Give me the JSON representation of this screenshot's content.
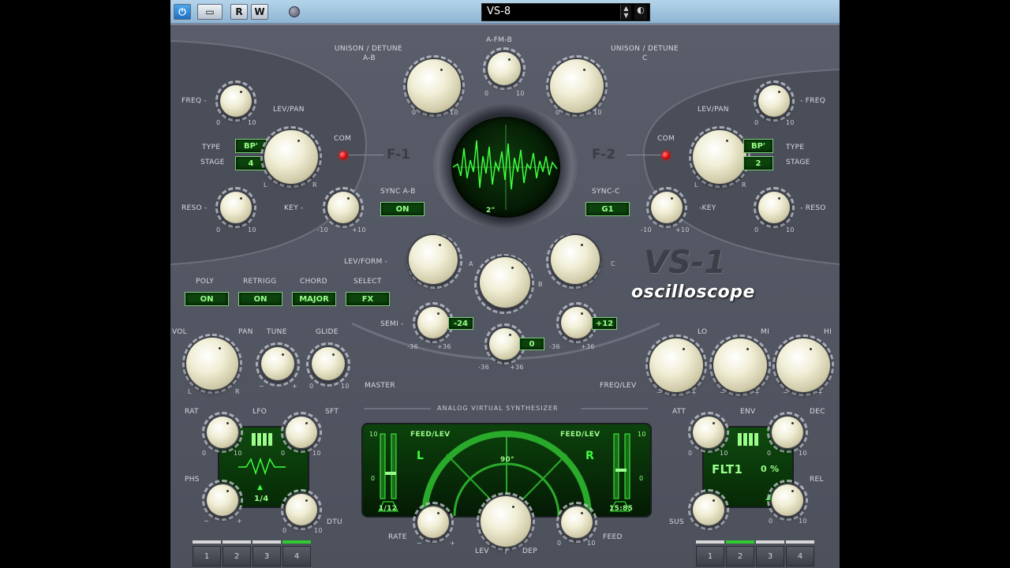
{
  "host": {
    "power_label": "",
    "r_label": "R",
    "w_label": "W",
    "preset_name": "VS-8"
  },
  "top": {
    "unison_ab_label": "UNISON / DETUNE",
    "unison_ab_sub": "A-B",
    "unison_c_label": "UNISON / DETUNE",
    "unison_c_sub": "C",
    "afmb_label": "A-FM-B",
    "zero": "0",
    "ten": "10"
  },
  "f1": {
    "title": "F-1",
    "freq_label": "FREQ -",
    "levpan_label": "LEV/PAN",
    "type_label": "TYPE",
    "stage_label": "STAGE",
    "type_value": "BP'",
    "stage_value": "4",
    "com_label": "COM",
    "reso_label": "RESO -",
    "key_label": "KEY -",
    "l": "L",
    "r": "R",
    "minus10": "-10",
    "plus10": "+10"
  },
  "f2": {
    "title": "F-2",
    "freq_label": "- FREQ",
    "levpan_label": "LEV/PAN",
    "type_label": "TYPE",
    "stage_label": "STAGE",
    "type_value": "BP'",
    "stage_value": "2",
    "com_label": "COM",
    "reso_label": "- RESO",
    "key_label": "-KEY",
    "l": "L",
    "r": "R",
    "minus10": "-10",
    "plus10": "+10"
  },
  "scope": {
    "time_label": "2\""
  },
  "sync": {
    "ab_label": "SYNC A-B",
    "ab_value": "ON",
    "c_label": "SYNC-C",
    "c_value": "G1"
  },
  "modes": {
    "poly_label": "POLY",
    "poly_value": "ON",
    "retrigg_label": "RETRIGG",
    "retrigg_value": "ON",
    "chord_label": "CHORD",
    "chord_value": "MAJOR",
    "select_label": "SELECT",
    "select_value": "FX"
  },
  "osc": {
    "levform_label": "LEV/FORM -",
    "a_label": "A",
    "b_label": "B",
    "c_label": "C",
    "semi_label": "SEMI -",
    "semi_a_value": "-24",
    "semi_b_value": "0",
    "semi_c_value": "+12",
    "minus36": "-36",
    "plus36": "+36"
  },
  "logo": {
    "name": "VS-1",
    "sub": "oscilloscope"
  },
  "master": {
    "vol_label": "VOL",
    "pan_label": "PAN",
    "tune_label": "TUNE",
    "glide_label": "GLIDE",
    "master_label": "MASTER",
    "l": "L",
    "r": "R",
    "minus": "−",
    "plus": "+",
    "zero": "0",
    "ten": "10"
  },
  "eq": {
    "lo_label": "LO",
    "mi_label": "MI",
    "hi_label": "HI",
    "freqlev_label": "FREQ/LEV",
    "minus": "−",
    "plus": "+"
  },
  "subtitle": "ANALOG   VIRTUAL   SYNTHESIZER",
  "lfo": {
    "rat_label": "RAT",
    "lfo_label": "LFO",
    "sft_label": "SFT",
    "phs_label": "PHS",
    "dtu_label": "DTU",
    "div_value": "1/4",
    "zero": "0",
    "ten": "10",
    "minus": "−",
    "plus": "+"
  },
  "fx": {
    "feedlev_l": "FEED/LEV",
    "feedlev_r": "FEED/LEV",
    "l": "L",
    "r": "R",
    "angle": "90°",
    "left_time": "1/12",
    "right_time": "15:85",
    "rate_label": "RATE",
    "lev_label": "LEV",
    "dep_label": "DEP",
    "slash": "/",
    "feed_label": "FEED",
    "ten": "10",
    "zero": "0"
  },
  "env": {
    "att_label": "ATT",
    "env_label": "ENV",
    "dec_label": "DEC",
    "sus_label": "SUS",
    "rel_label": "REL",
    "target": "FLT1",
    "amount": "0 %",
    "zero": "0",
    "ten": "10"
  },
  "tabs_left": [
    "1",
    "2",
    "3",
    "4"
  ],
  "tabs_right": [
    "1",
    "2",
    "3",
    "4"
  ],
  "colors": {
    "panel": "#545864",
    "lcd_green": "#9aff8a",
    "led_red": "#e00000",
    "host_bar": "#a4c6e2"
  }
}
